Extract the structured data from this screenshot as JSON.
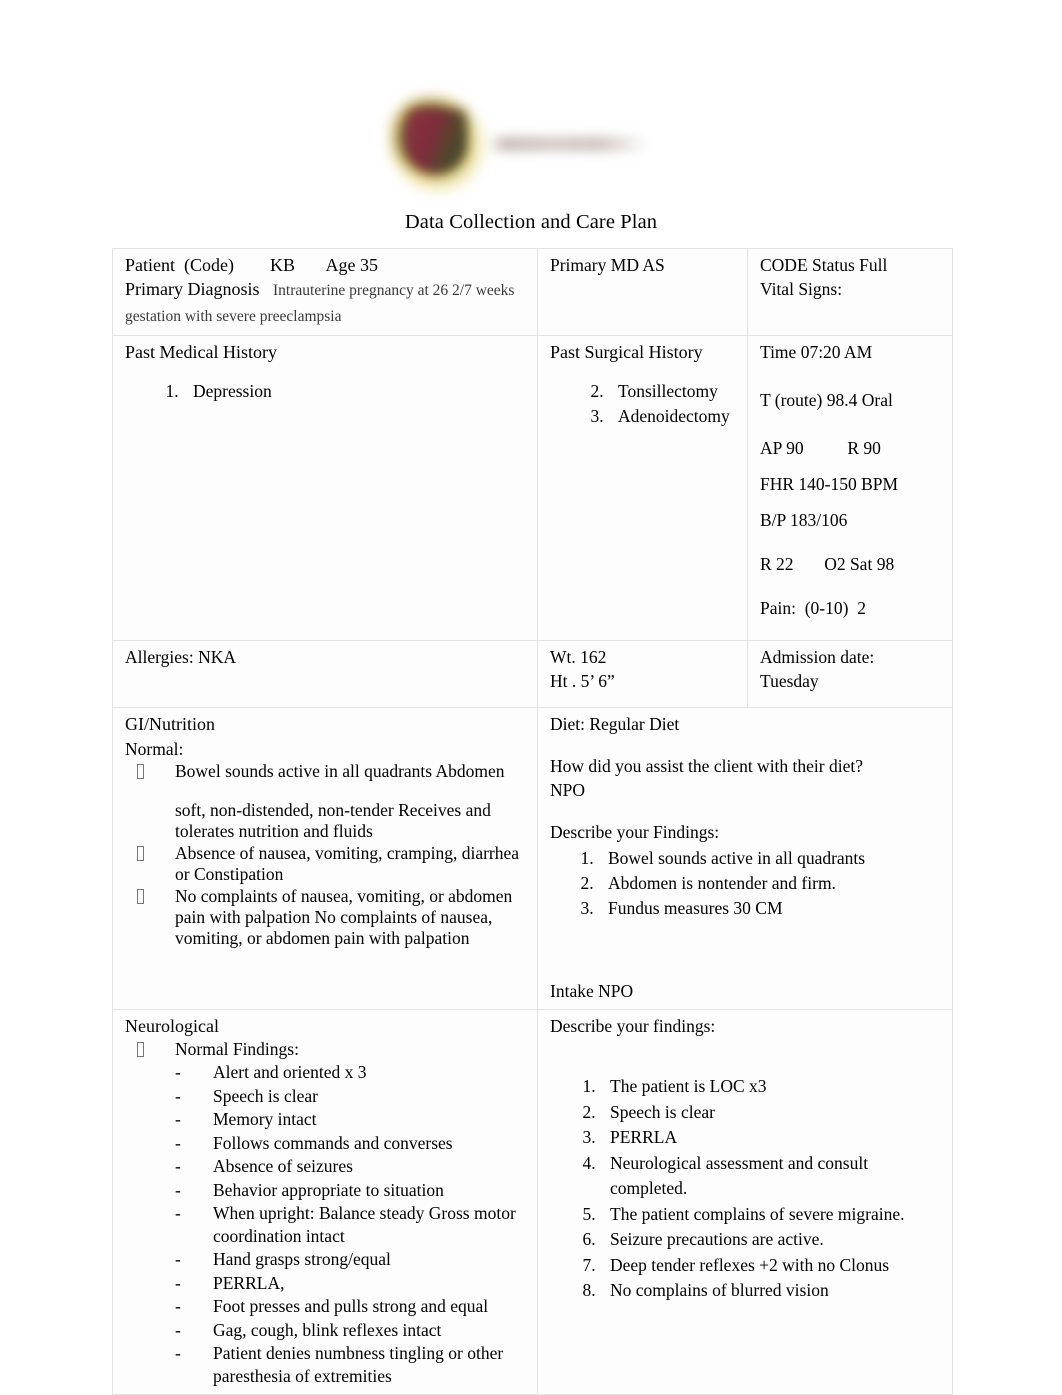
{
  "document": {
    "title": "Data Collection and Care Plan",
    "logo": {
      "shield_colors": [
        "#8d2f3f",
        "#5d4c2d",
        "#d8c25a"
      ],
      "wordmark_color": "#a94961"
    }
  },
  "table": {
    "identification": {
      "patient_label": "Patient  (Code)",
      "patient_code": "KB",
      "age": "Age 35",
      "primary_md": "Primary MD AS",
      "code_status": "CODE Status Full",
      "diagnosis_label": "Primary Diagnosis",
      "diagnosis_value": "Intrauterine pregnancy at 26 2/7 weeks gestation with severe preeclampsia",
      "vital_signs_label": "Vital Signs:"
    },
    "history": {
      "past_medical_label": "Past Medical History",
      "past_medical_items": [
        "Depression"
      ],
      "past_surgical_label": "Past Surgical History",
      "past_surgical_items": [
        "Tonsillectomy",
        "Adenoidectomy"
      ],
      "past_surgical_start": 2
    },
    "vitals": {
      "time": "Time 07:20 AM",
      "temperature": "T (route) 98.4 Oral",
      "ap": "AP 90",
      "r_pulse": "R 90",
      "fhr": "FHR 140-150 BPM",
      "bp": "B/P 183/106",
      "respiration": "R 22",
      "o2_sat": "O2 Sat 98",
      "pain": "Pain:  (0-10)  2"
    },
    "allergies_row": {
      "allergies": "Allergies:  NKA",
      "weight": "Wt. 162",
      "height": "Ht . 5’ 6”",
      "admission_label": "Admission date:",
      "admission_value": "Tuesday"
    },
    "gi_nutrition": {
      "section_label": "GI/Nutrition",
      "normal_label": "Normal:",
      "bullets": [
        "Bowel sounds active in all quadrants Abdomen",
        "Absence of nausea, vomiting, cramping, diarrhea or Constipation",
        "No complaints of nausea, vomiting, or abdomen pain with palpation No complaints of nausea, vomiting, or abdomen pain with palpation"
      ],
      "continuation": "soft, non-distended, non-tender Receives and tolerates nutrition and fluids",
      "diet_label": "Diet:  Regular Diet",
      "assist_question": "How did you assist the client with their diet?",
      "assist_answer": "NPO",
      "findings_label": "Describe your Findings:",
      "findings": [
        "Bowel sounds active in all quadrants",
        "Abdomen is nontender and firm.",
        "Fundus measures 30 CM"
      ],
      "intake": "Intake  NPO"
    },
    "neurological": {
      "section_label": "Neurological",
      "normal_findings_label": "Normal Findings:",
      "normal_findings": [
        "Alert and oriented x 3",
        "Speech is clear",
        "Memory  intact",
        "Follows commands and converses",
        "Absence of seizures",
        "Behavior appropriate to situation",
        "When upright: Balance steady Gross motor coordination intact",
        "Hand grasps strong/equal",
        "PERRLA,",
        "Foot presses and pulls strong and equal",
        "Gag, cough, blink reflexes intact",
        "Patient denies numbness tingling or other paresthesia of extremities"
      ],
      "describe_label": "Describe your findings:",
      "describe_findings": [
        "The patient is LOC x3",
        "Speech is clear",
        "PERRLA",
        "Neurological assessment and consult completed.",
        "The patient complains of severe migraine.",
        "Seizure precautions are active.",
        "Deep tender reflexes +2 with no Clonus",
        "No complains of blurred vision"
      ]
    }
  }
}
